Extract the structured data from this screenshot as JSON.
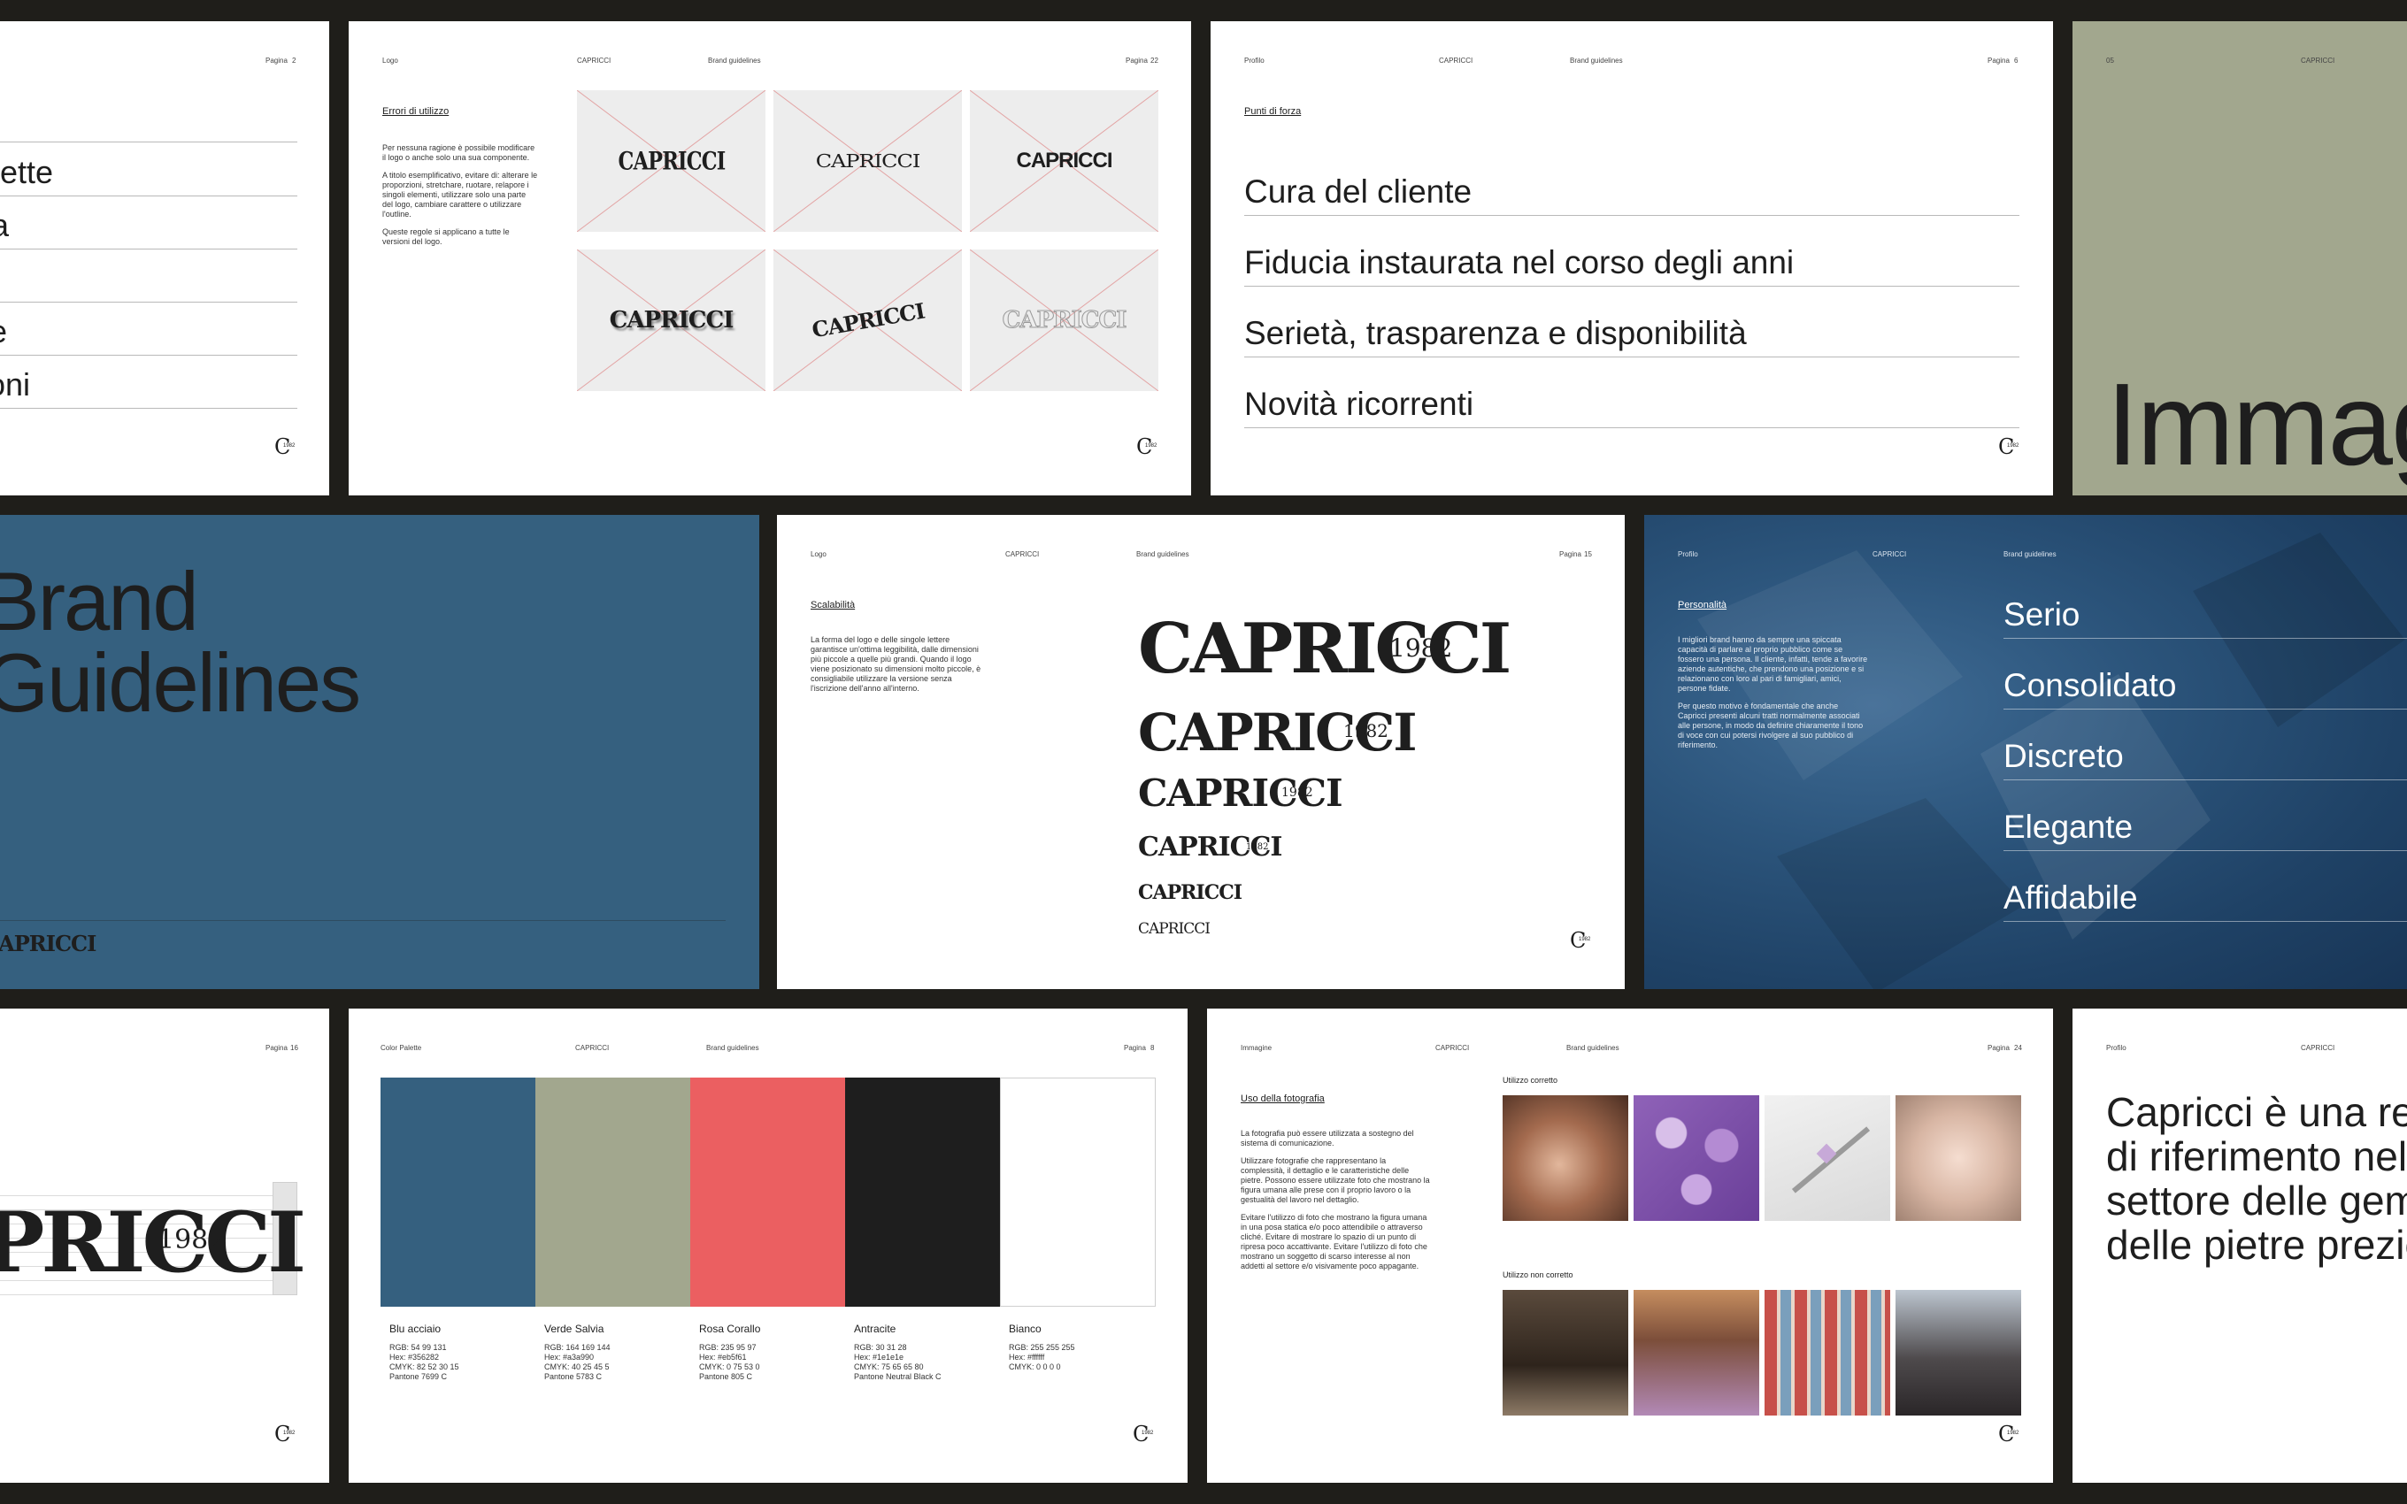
{
  "colors": {
    "bg": "#1f1e1a",
    "blu_acciaio": "#35607f",
    "verde_salvia": "#a2a78e",
    "rosa_corallo": "#eb5f61",
    "antracite": "#1e1e1e",
    "bianco": "#ffffff"
  },
  "brand": {
    "wordmark": "CAPRICCI",
    "year": "1982"
  },
  "p_index": {
    "page_label": "Pagina",
    "page_num": "2",
    "items": [
      "ette",
      "a",
      "",
      "e",
      "oni"
    ]
  },
  "p_errors": {
    "hdr_section": "Logo",
    "hdr_brand": "CAPRICCI",
    "hdr_title": "Brand guidelines",
    "page_label": "Pagina",
    "page_num": "22",
    "heading": "Errori di utilizzo",
    "para1": "Per nessuna ragione è possibile modificare il logo o anche solo una sua componente.",
    "para2": "A titolo esemplificativo, evitare di: alterare le proporzioni, stretchare, ruotare, relapore i singoli elementi, utilizzare solo una parte del logo, cambiare carattere o utilizzare l'outline.",
    "para3": "Queste regole si applicano a tutte le versioni del logo."
  },
  "p_strengths": {
    "hdr_section": "Profilo",
    "hdr_brand": "CAPRICCI",
    "hdr_title": "Brand guidelines",
    "page_label": "Pagina",
    "page_num": "6",
    "heading": "Punti di forza",
    "items": [
      "Cura del cliente",
      "Fiducia instaurata nel corso degli anni",
      "Serietà, trasparenza e disponibilità",
      "Novità ricorrenti"
    ]
  },
  "p_immagine": {
    "hdr_num": "05",
    "hdr_brand": "CAPRICCI",
    "title": "Immagine"
  },
  "p_cover": {
    "title_line1": "Brand",
    "title_line2": "Guidelines"
  },
  "p_scale": {
    "hdr_section": "Logo",
    "hdr_brand": "CAPRICCI",
    "hdr_title": "Brand guidelines",
    "page_label": "Pagina",
    "page_num": "15",
    "heading": "Scalabilità",
    "para": "La forma del logo e delle singole lettere garantisce un'ottima leggibilità, dalle dimensioni più piccole a quelle più grandi. Quando il logo viene posizionato su dimensioni molto piccole, è consigliabile utilizzare la versione senza l'iscrizione dell'anno all'interno."
  },
  "p_personality": {
    "hdr_section": "Profilo",
    "hdr_brand": "CAPRICCI",
    "hdr_title": "Brand guidelines",
    "heading": "Personalità",
    "para1": "I migliori brand hanno da sempre una spiccata capacità di parlare al proprio pubblico come se fossero una persona. Il cliente, infatti, tende a favorire aziende autentiche, che prendono una posizione e si relazionano con loro al pari di famigliari, amici, persone fidate.",
    "para2": "Per questo motivo è fondamentale che anche Capricci presenti alcuni tratti normalmente associati alle persone, in modo da definire chiaramente il tono di voce con cui potersi rivolgere al suo pubblico di riferimento.",
    "items": [
      "Serio",
      "Consolidato",
      "Discreto",
      "Elegante",
      "Affidabile"
    ]
  },
  "p_grid": {
    "page_label": "Pagina",
    "page_num": "16"
  },
  "p_palette": {
    "hdr_section": "Color Palette",
    "hdr_brand": "CAPRICCI",
    "hdr_title": "Brand guidelines",
    "page_label": "Pagina",
    "page_num": "8",
    "swatches": [
      {
        "name": "Blu acciaio",
        "specs": [
          "RGB: 54 99 131",
          "Hex: #356282",
          "CMYK: 82 52 30 15",
          "Pantone 7699 C"
        ]
      },
      {
        "name": "Verde Salvia",
        "specs": [
          "RGB: 164 169 144",
          "Hex: #a3a990",
          "CMYK: 40 25 45 5",
          "Pantone 5783 C"
        ]
      },
      {
        "name": "Rosa Corallo",
        "specs": [
          "RGB: 235 95 97",
          "Hex: #eb5f61",
          "CMYK: 0 75 53 0",
          "Pantone 805 C"
        ]
      },
      {
        "name": "Antracite",
        "specs": [
          "RGB: 30 31 28",
          "Hex: #1e1e1e",
          "CMYK: 75 65 65 80",
          "Pantone Neutral Black C"
        ]
      },
      {
        "name": "Bianco",
        "specs": [
          "RGB: 255 255 255",
          "Hex: #ffffff",
          "CMYK: 0 0 0 0",
          ""
        ]
      }
    ]
  },
  "p_photo": {
    "hdr_section": "Immagine",
    "hdr_brand": "CAPRICCI",
    "hdr_title": "Brand guidelines",
    "page_label": "Pagina",
    "page_num": "24",
    "heading": "Uso della fotografia",
    "para1": "La fotografia può essere utilizzata a sostegno del sistema di comunicazione.",
    "para2": "Utilizzare fotografie che rappresentano la complessità, il dettaglio e le caratteristiche delle pietre. Possono essere utilizzate foto che mostrano la figura umana alle prese con il proprio lavoro o la gestualità del lavoro nel dettaglio.",
    "para3": "Evitare l'utilizzo di foto che mostrano la figura umana in una posa statica e/o poco attendibile o attraverso cliché. Evitare di mostrare lo spazio di un punto di ripresa poco accattivante. Evitare l'utilizzo di foto che mostrano un soggetto di scarso interesse al non addetti al settore e/o visivamente poco appagante.",
    "correct_label": "Utilizzo corretto",
    "incorrect_label": "Utilizzo non corretto"
  },
  "p_intro": {
    "hdr_section": "Profilo",
    "hdr_brand": "CAPRICCI",
    "text": "Capricci è una realtà di riferimento nel settore delle gemme e delle pietre preziose."
  }
}
